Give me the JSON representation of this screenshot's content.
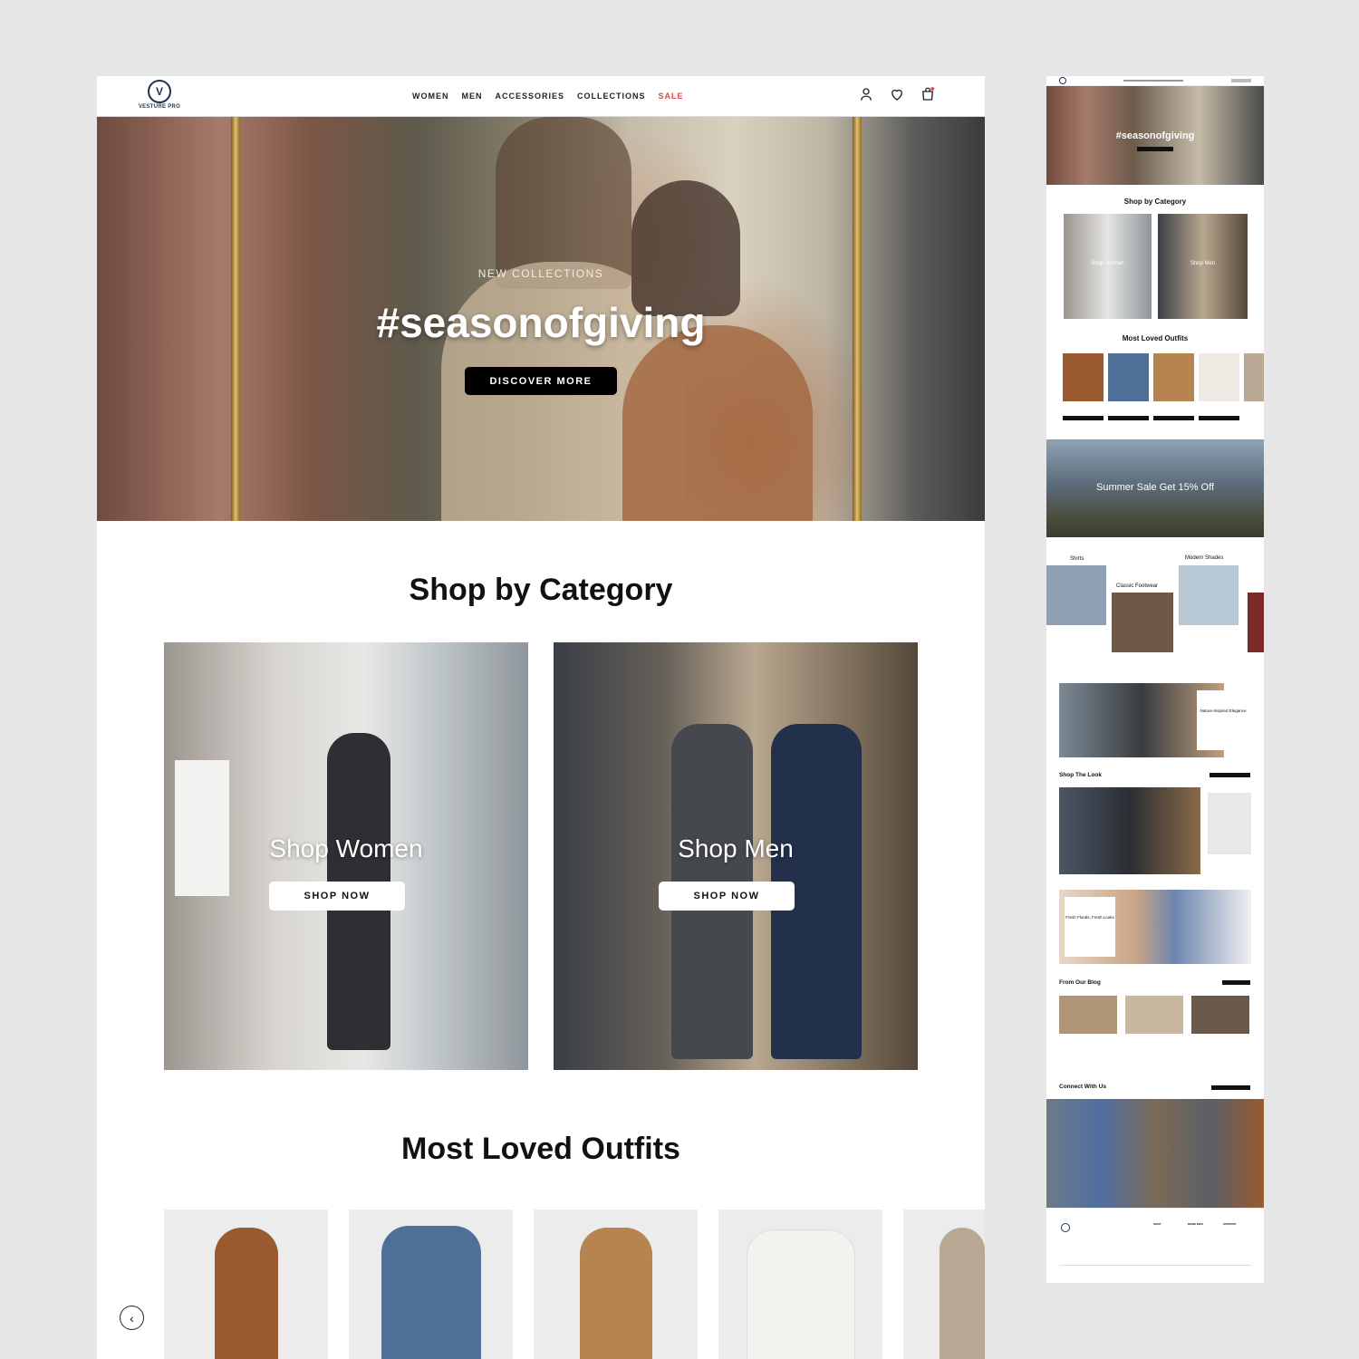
{
  "header": {
    "logo_text": "VESTURE PRO",
    "logo_mark": "V",
    "nav": [
      "WOMEN",
      "MEN",
      "ACCESSORIES",
      "COLLECTIONS",
      "SALE"
    ],
    "icons": [
      "user-icon",
      "heart-icon",
      "cart-icon"
    ]
  },
  "hero": {
    "subtitle": "NEW COLLECTIONS",
    "title": "#seasonofgiving",
    "button": "DISCOVER MORE"
  },
  "categories": {
    "heading": "Shop by Category",
    "items": [
      {
        "label": "Shop Women",
        "button": "SHOP NOW"
      },
      {
        "label": "Shop Men",
        "button": "SHOP NOW"
      }
    ]
  },
  "outfits": {
    "heading": "Most Loved Outfits"
  },
  "colors": {
    "accent_sale": "#d44b4b",
    "brand_navy": "#1f3553",
    "button_dark": "#000000",
    "page_bg": "#e6e6e6"
  },
  "thumbnail": {
    "hero_title": "#seasonofgiving",
    "shop_by_category": "Shop by Category",
    "shop_women": "Shop Women",
    "shop_men": "Shop Men",
    "most_loved": "Most Loved Outfits",
    "sale_banner": "Summer Sale Get 15% Off",
    "cat_shirts": "Shirts",
    "cat_footwear": "Classic Footwear",
    "cat_shades": "Modern Shades",
    "limited_title": "Nature-Inspired Elegance",
    "shop_the_look": "Shop The Look",
    "florals_title": "Fresh Florals, Fresh Looks",
    "blog_heading": "From Our Blog",
    "connect_heading": "Connect With Us",
    "footer_cols": [
      "SHOP",
      "MORE INFO",
      "SUPPORT"
    ]
  }
}
